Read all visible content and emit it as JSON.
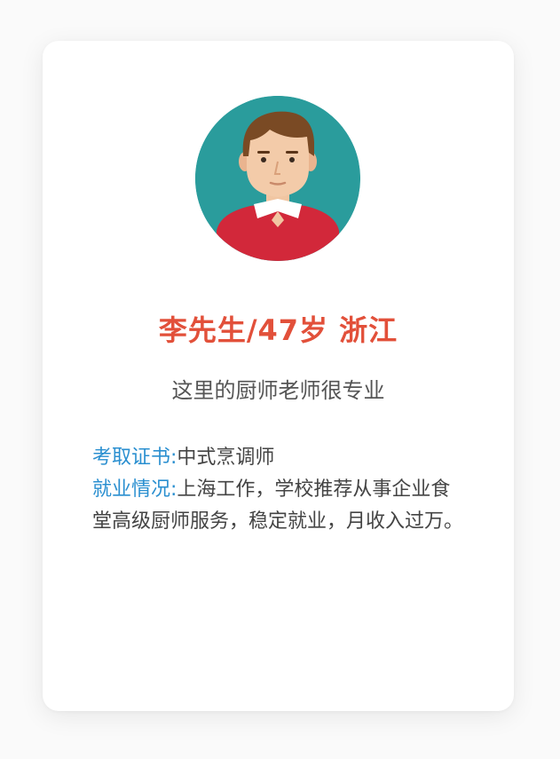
{
  "profile": {
    "name_line": "李先生/47岁 浙江",
    "tagline": "这里的厨师老师很专业",
    "certificate_label": "考取证书:",
    "certificate_value": "中式烹调师",
    "employment_label": "就业情况:",
    "employment_value": "上海工作，学校推荐从事企业食堂高级厨师服务，稳定就业，月收入过万。"
  },
  "avatar": {
    "icon": "male-avatar-icon",
    "background_color": "#2a9c9c",
    "sweater_color": "#d2283a",
    "hair_color": "#7a4a24"
  },
  "colors": {
    "name_color": "#e2503a",
    "label_color": "#2a8fd0",
    "text_color": "#444444"
  }
}
